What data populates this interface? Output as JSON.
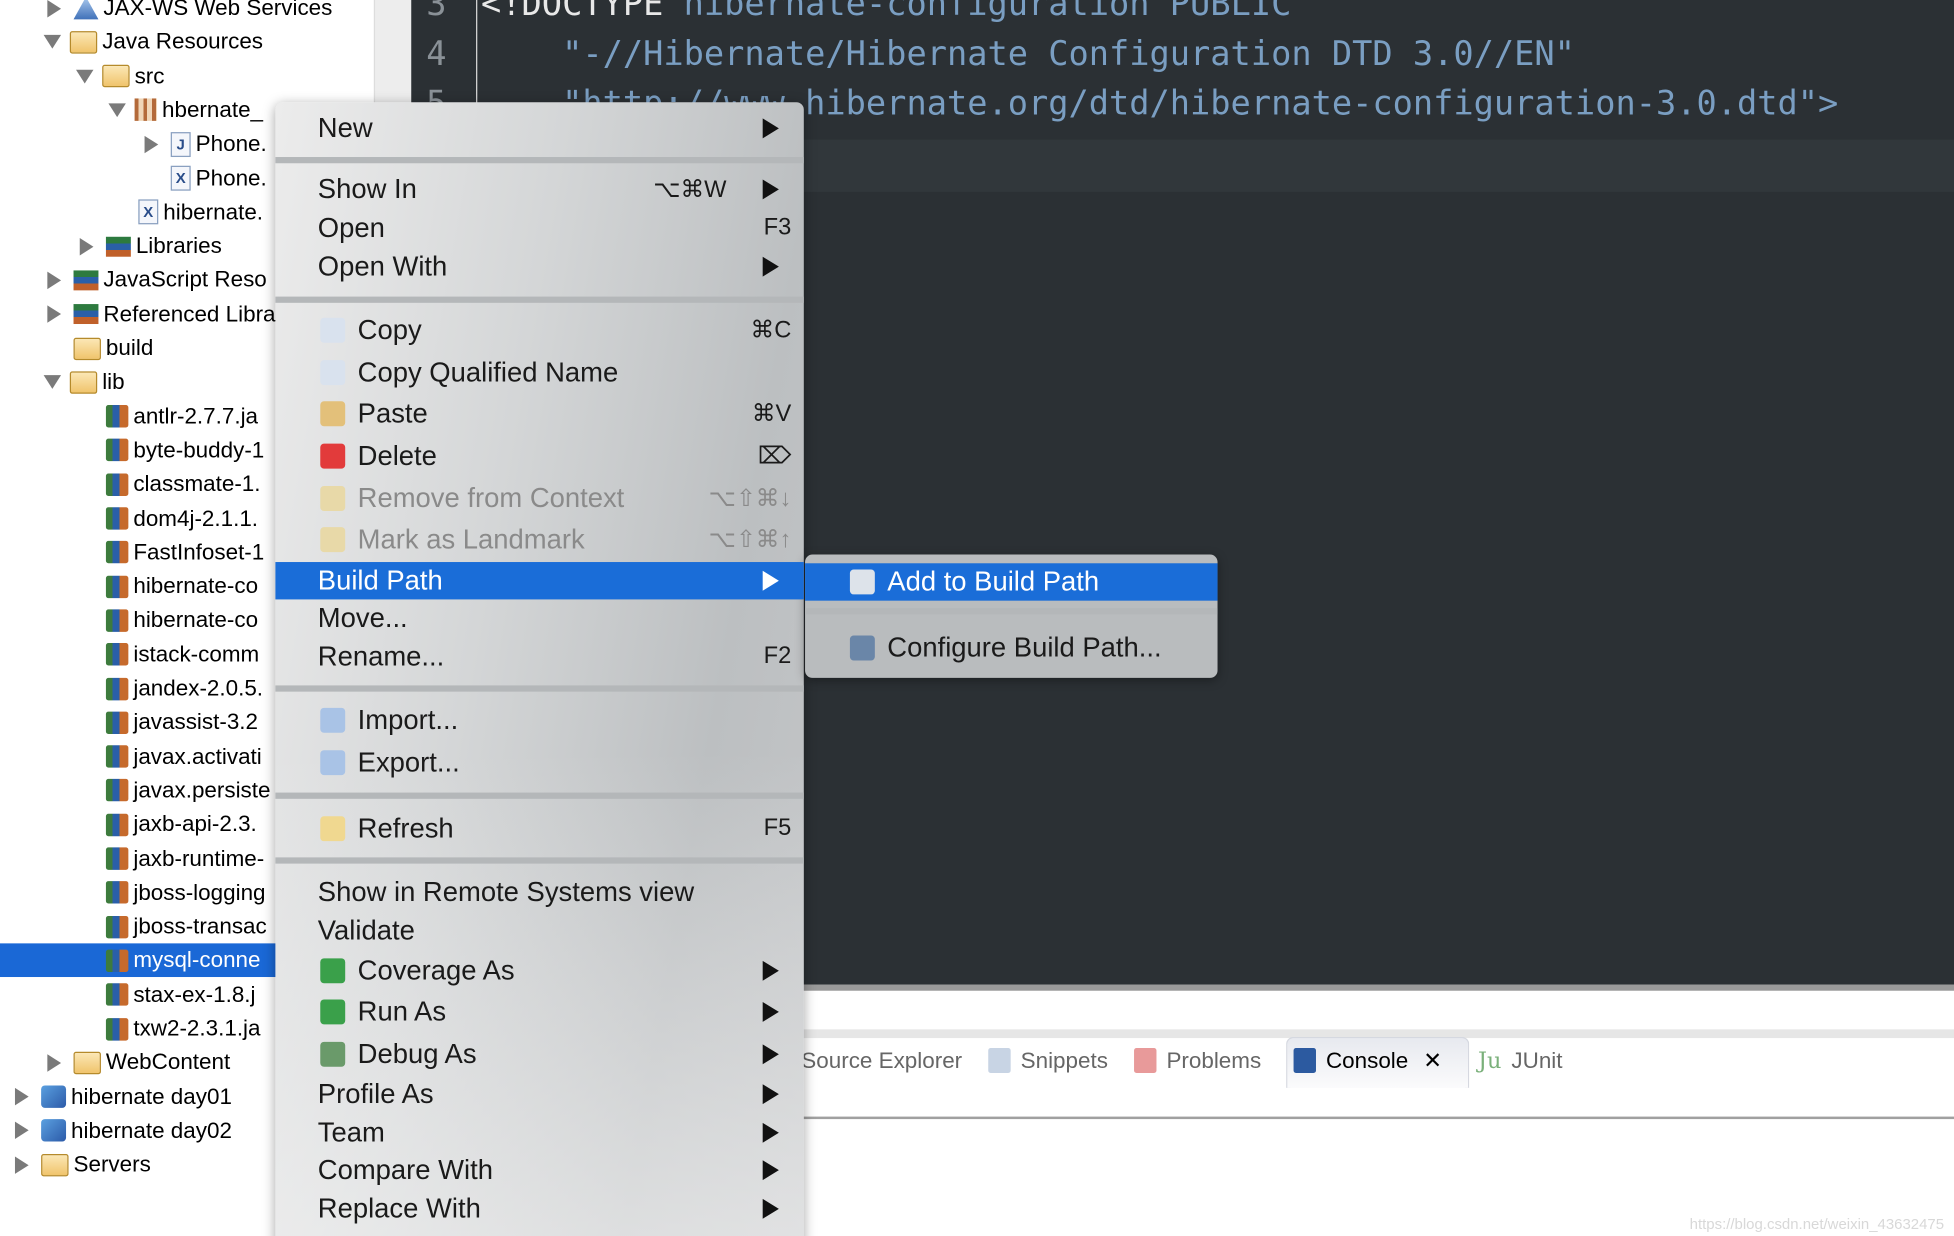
{
  "editor": {
    "lines": [
      {
        "num": "3",
        "keyword": "<!DOCTYPE",
        "text": " hibernate-configuration PUBLIC"
      },
      {
        "num": "4",
        "keyword": "",
        "text": "    \"-//Hibernate/Hibernate Configuration DTD 3.0//EN\""
      },
      {
        "num": "5",
        "keyword": "",
        "text": "    \"http://www.hibernate.org/dtd/hibernate-configuration-3.0.dtd\">"
      }
    ]
  },
  "tree": {
    "items": [
      {
        "label": "JAX-WS Web Services",
        "depth": 1,
        "arrow": "collapsed",
        "icon": "ws"
      },
      {
        "label": "Java Resources",
        "depth": 1,
        "arrow": "expanded",
        "icon": "folder"
      },
      {
        "label": "src",
        "depth": 2,
        "arrow": "expanded",
        "icon": "folder"
      },
      {
        "label": "hbernate_",
        "depth": 3,
        "arrow": "expanded",
        "icon": "pkg"
      },
      {
        "label": "Phone.",
        "depth": 4,
        "arrow": "collapsed",
        "icon": "file",
        "glyph": "J"
      },
      {
        "label": "Phone.",
        "depth": 4,
        "arrow": "none",
        "icon": "file",
        "glyph": "X"
      },
      {
        "label": "hibernate.",
        "depth": 3,
        "arrow": "none",
        "icon": "file",
        "glyph": "X"
      },
      {
        "label": "Libraries",
        "depth": 2,
        "arrow": "collapsed",
        "icon": "lib"
      },
      {
        "label": "JavaScript Reso",
        "depth": 1,
        "arrow": "collapsed",
        "icon": "lib"
      },
      {
        "label": "Referenced Libra",
        "depth": 1,
        "arrow": "collapsed",
        "icon": "lib"
      },
      {
        "label": "build",
        "depth": 1,
        "arrow": "none",
        "icon": "folder"
      },
      {
        "label": "lib",
        "depth": 1,
        "arrow": "expanded",
        "icon": "folder"
      },
      {
        "label": "antlr-2.7.7.ja",
        "depth": 2,
        "arrow": "none",
        "icon": "jar"
      },
      {
        "label": "byte-buddy-1",
        "depth": 2,
        "arrow": "none",
        "icon": "jar"
      },
      {
        "label": "classmate-1.",
        "depth": 2,
        "arrow": "none",
        "icon": "jar"
      },
      {
        "label": "dom4j-2.1.1.",
        "depth": 2,
        "arrow": "none",
        "icon": "jar"
      },
      {
        "label": "FastInfoset-1",
        "depth": 2,
        "arrow": "none",
        "icon": "jar"
      },
      {
        "label": "hibernate-co",
        "depth": 2,
        "arrow": "none",
        "icon": "jar"
      },
      {
        "label": "hibernate-co",
        "depth": 2,
        "arrow": "none",
        "icon": "jar"
      },
      {
        "label": "istack-comm",
        "depth": 2,
        "arrow": "none",
        "icon": "jar"
      },
      {
        "label": "jandex-2.0.5.",
        "depth": 2,
        "arrow": "none",
        "icon": "jar"
      },
      {
        "label": "javassist-3.2",
        "depth": 2,
        "arrow": "none",
        "icon": "jar"
      },
      {
        "label": "javax.activati",
        "depth": 2,
        "arrow": "none",
        "icon": "jar"
      },
      {
        "label": "javax.persiste",
        "depth": 2,
        "arrow": "none",
        "icon": "jar"
      },
      {
        "label": "jaxb-api-2.3.",
        "depth": 2,
        "arrow": "none",
        "icon": "jar"
      },
      {
        "label": "jaxb-runtime-",
        "depth": 2,
        "arrow": "none",
        "icon": "jar"
      },
      {
        "label": "jboss-logging",
        "depth": 2,
        "arrow": "none",
        "icon": "jar"
      },
      {
        "label": "jboss-transac",
        "depth": 2,
        "arrow": "none",
        "icon": "jar"
      },
      {
        "label": "mysql-conne",
        "depth": 2,
        "arrow": "none",
        "icon": "jar",
        "selected": true
      },
      {
        "label": "stax-ex-1.8.j",
        "depth": 2,
        "arrow": "none",
        "icon": "jar"
      },
      {
        "label": "txw2-2.3.1.ja",
        "depth": 2,
        "arrow": "none",
        "icon": "jar"
      },
      {
        "label": "WebContent",
        "depth": 1,
        "arrow": "collapsed",
        "icon": "folder"
      },
      {
        "label": "hibernate day01",
        "depth": 0,
        "arrow": "collapsed",
        "icon": "proj"
      },
      {
        "label": "hibernate day02",
        "depth": 0,
        "arrow": "collapsed",
        "icon": "proj"
      },
      {
        "label": "Servers",
        "depth": 0,
        "arrow": "collapsed",
        "icon": "folder"
      }
    ]
  },
  "context_menu": {
    "items": [
      {
        "label": "New",
        "submenu": true
      },
      {
        "separator": true
      },
      {
        "label": "Show In",
        "shortcut": "⌥⌘W",
        "submenu": true
      },
      {
        "label": "Open",
        "shortcut": "F3"
      },
      {
        "label": "Open With",
        "submenu": true
      },
      {
        "separator": true
      },
      {
        "label": "Copy",
        "shortcut": "⌘C",
        "icon": "copy-icon",
        "color": "#d9e2ee"
      },
      {
        "label": "Copy Qualified Name",
        "icon": "copy-qualified-name-icon",
        "color": "#d9e2ee"
      },
      {
        "label": "Paste",
        "shortcut": "⌘V",
        "icon": "paste-icon",
        "color": "#e3c07a"
      },
      {
        "label": "Delete",
        "shortcut": "⌦",
        "icon": "delete-icon",
        "color": "#e23b3b"
      },
      {
        "label": "Remove from Context",
        "shortcut": "⌥⇧⌘↓",
        "icon": "remove-context-icon",
        "color": "#e8d9a8",
        "disabled": true
      },
      {
        "label": "Mark as Landmark",
        "shortcut": "⌥⇧⌘↑",
        "icon": "landmark-icon",
        "color": "#e8d9a8",
        "disabled": true
      },
      {
        "label": "Build Path",
        "submenu": true,
        "highlighted": true
      },
      {
        "label": "Move..."
      },
      {
        "label": "Rename...",
        "shortcut": "F2"
      },
      {
        "separator": true
      },
      {
        "label": "Import...",
        "icon": "import-icon",
        "color": "#a9c3e6"
      },
      {
        "label": "Export...",
        "icon": "export-icon",
        "color": "#a9c3e6"
      },
      {
        "separator": true
      },
      {
        "label": "Refresh",
        "shortcut": "F5",
        "icon": "refresh-icon",
        "color": "#f0d890"
      },
      {
        "separator": true
      },
      {
        "label": "Show in Remote Systems view"
      },
      {
        "label": "Validate"
      },
      {
        "label": "Coverage As",
        "submenu": true,
        "icon": "coverage-icon",
        "color": "#3aa04a"
      },
      {
        "label": "Run As",
        "submenu": true,
        "icon": "run-icon",
        "color": "#3aa04a"
      },
      {
        "label": "Debug As",
        "submenu": true,
        "icon": "debug-icon",
        "color": "#6a9a6a"
      },
      {
        "label": "Profile As",
        "submenu": true
      },
      {
        "label": "Team",
        "submenu": true
      },
      {
        "label": "Compare With",
        "submenu": true
      },
      {
        "label": "Replace With",
        "submenu": true
      }
    ]
  },
  "build_path_submenu": {
    "items": [
      {
        "label": "Add to Build Path",
        "icon": "jar-binary-icon",
        "color": "#dde3ea",
        "highlighted": true
      },
      {
        "separator": true
      },
      {
        "label": "Configure Build Path...",
        "icon": "configure-build-path-icon",
        "color": "#6a86a8"
      }
    ]
  },
  "bottom_tabs": [
    {
      "label": "Source Explorer",
      "icon": ""
    },
    {
      "label": "Snippets",
      "icon": "snippets-icon",
      "color": "#c8d4e4"
    },
    {
      "label": "Problems",
      "icon": "problems-icon",
      "color": "#e89a9a"
    },
    {
      "label": "Console",
      "icon": "console-icon",
      "color": "#2c5aa0",
      "active": true,
      "close": "✕"
    },
    {
      "label": "JUnit",
      "icon": "junit-icon",
      "glyph": "Ju",
      "color": "#7ab07a"
    }
  ],
  "watermark": "https://blog.csdn.net/weixin_43632475"
}
